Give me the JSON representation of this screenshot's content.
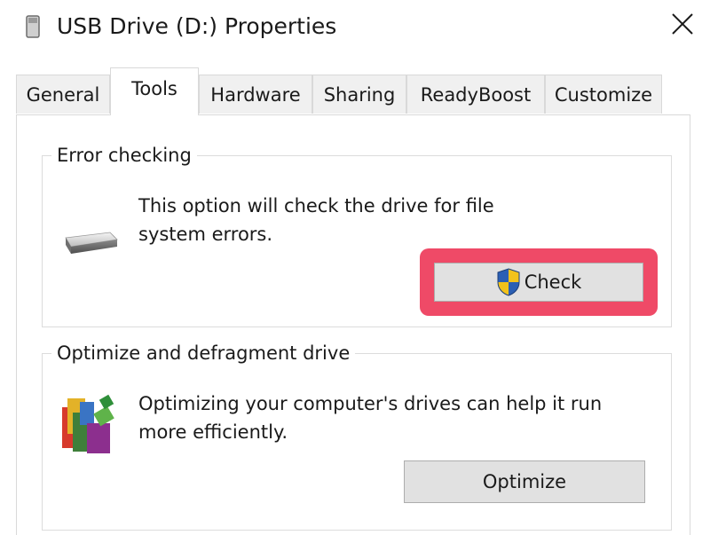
{
  "window": {
    "title": "USB Drive (D:) Properties"
  },
  "tabs": [
    {
      "label": "General",
      "active": false
    },
    {
      "label": "Tools",
      "active": true
    },
    {
      "label": "Hardware",
      "active": false
    },
    {
      "label": "Sharing",
      "active": false
    },
    {
      "label": "ReadyBoost",
      "active": false
    },
    {
      "label": "Customize",
      "active": false
    }
  ],
  "error_checking": {
    "heading": "Error checking",
    "description": "This option will check the drive for file system errors.",
    "button_label": "Check",
    "button_icon": "uac-shield-icon",
    "highlight_color": "#ef4a67"
  },
  "optimize": {
    "heading": "Optimize and defragment drive",
    "description": "Optimizing your computer's drives can help it run more efficiently.",
    "button_label": "Optimize",
    "icon": "defrag-icon"
  },
  "icons": {
    "title": "usb-drive-icon",
    "close": "close-icon",
    "drive": "drive-icon"
  }
}
